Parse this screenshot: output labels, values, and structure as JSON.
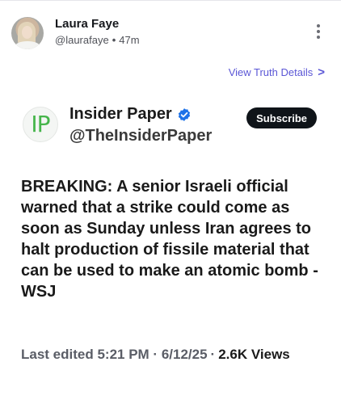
{
  "post": {
    "author_name": "Laura Faye",
    "handle": "@laurafaye",
    "separator": "•",
    "time_ago": "47m",
    "view_details_label": "View Truth Details",
    "view_details_chevron": ">"
  },
  "embed": {
    "logo_text": "IP",
    "name": "Insider Paper",
    "handle": "@TheInsiderPaper",
    "subscribe_label": "Subscribe",
    "body": "BREAKING: A senior Israeli official warned that a strike could come as soon as Sunday unless Iran agrees to halt production of fissile material that can be used to make an atomic bomb - WSJ"
  },
  "footer": {
    "edited_label": "Last edited 5:21 PM · 6/12/25",
    "separator": "·",
    "view_count": "2.6K",
    "views_label": "Views"
  },
  "colors": {
    "accent": "#5b57d6",
    "verified": "#1d72e8",
    "logo_green": "#46b54b",
    "button_dark": "#0f1419"
  },
  "icons": {
    "more": "more-vertical-icon",
    "chevron": "chevron-right-icon",
    "verified": "verified-badge-icon"
  }
}
